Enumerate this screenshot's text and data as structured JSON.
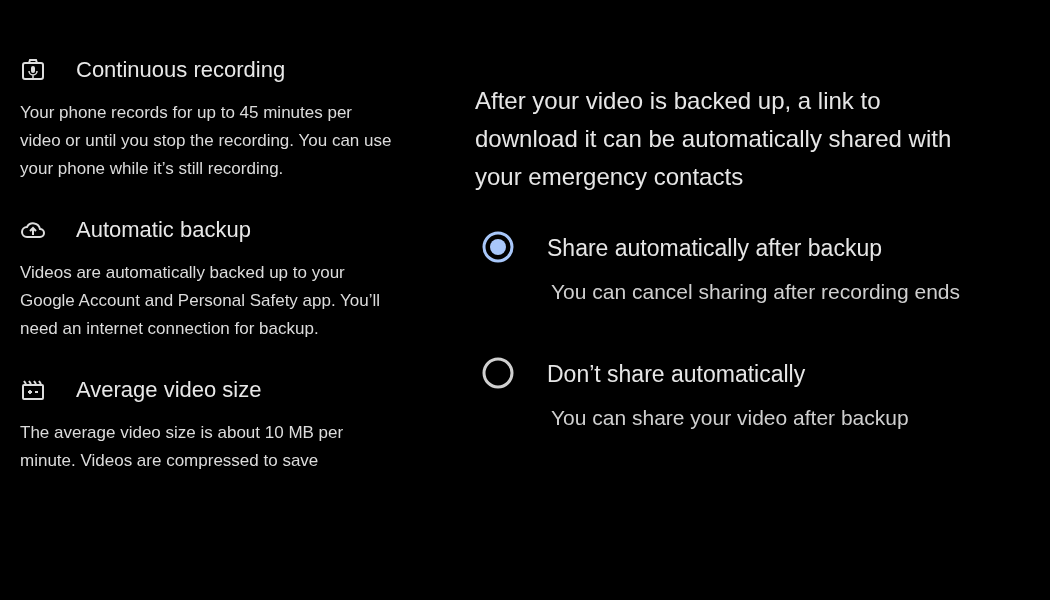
{
  "features": [
    {
      "kind": "mic",
      "title": "Continuous recording",
      "description": "Your phone records for up to 45 minutes per video or until you stop the recording. You can use your phone while it’s still recording."
    },
    {
      "kind": "cloud",
      "title": "Automatic backup",
      "description": "Videos are automatically backed up to your Google Account and Personal Safety app. You’ll need an internet connection for backup."
    },
    {
      "kind": "film",
      "title": "Average video size",
      "description": "The average video size is about 10 MB per minute. Videos are compressed to save"
    }
  ],
  "sharing": {
    "intro": "After your video is backed up, a link to download it can be automatically shared with your emergency contacts",
    "options": [
      {
        "label": "Share automatically after backup",
        "description": "You can cancel sharing after recording ends",
        "selected": true
      },
      {
        "label": "Don’t share automatically",
        "description": "You can share your video after backup",
        "selected": false
      }
    ]
  }
}
